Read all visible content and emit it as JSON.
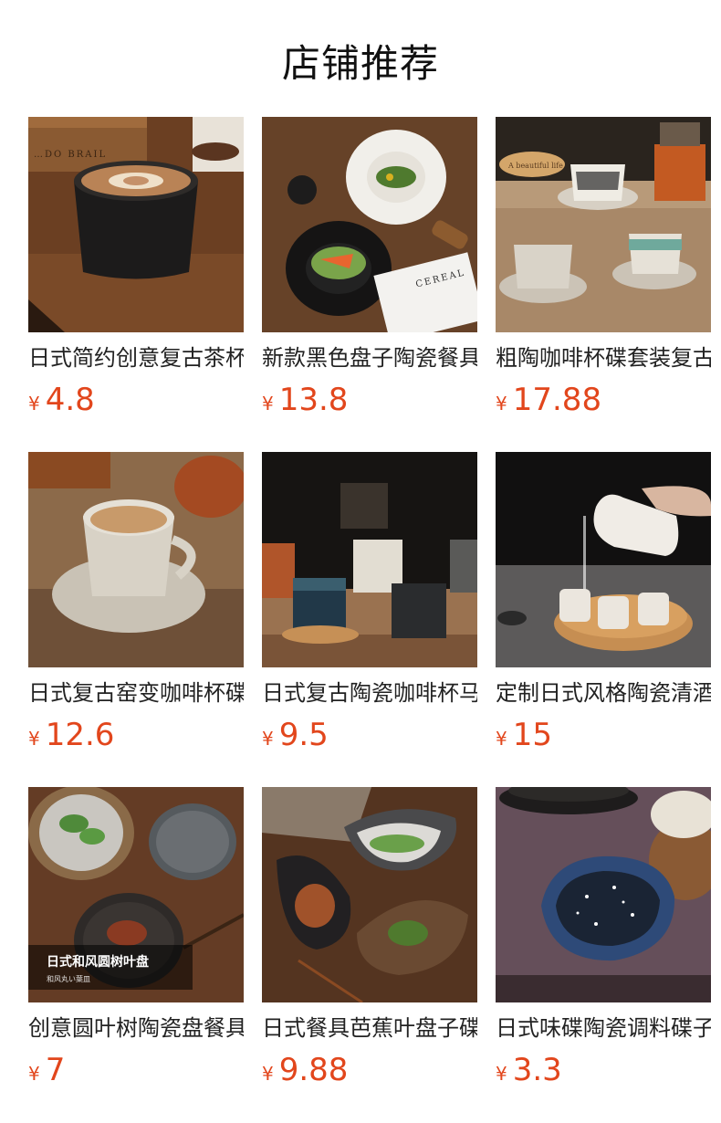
{
  "header": {
    "title": "店铺推荐"
  },
  "products": [
    {
      "name": "日式简约创意复古茶杯",
      "currency": "¥",
      "price": "4.8",
      "image": "black-coffee-cup",
      "image_text": [
        "…DO BRAIL"
      ]
    },
    {
      "name": "新款黑色盘子陶瓷餐具",
      "currency": "¥",
      "price": "13.8",
      "image": "black-plate-salad",
      "image_text": [
        "CEREAL"
      ]
    },
    {
      "name": "粗陶咖啡杯碟套装复古",
      "currency": "¥",
      "price": "17.88",
      "image": "cups-saucers-table",
      "image_text": [
        "A beautiful life"
      ]
    },
    {
      "name": "日式复古窑变咖啡杯碟",
      "currency": "¥",
      "price": "12.6",
      "image": "milk-tea-cup",
      "image_text": []
    },
    {
      "name": "日式复古陶瓷咖啡杯马克杯",
      "currency": "¥",
      "price": "9.5",
      "image": "mugs-stack",
      "image_text": []
    },
    {
      "name": "定制日式风格陶瓷清酒壶",
      "currency": "¥",
      "price": "15",
      "image": "sake-set",
      "image_text": []
    },
    {
      "name": "创意圆叶树陶瓷盘餐具",
      "currency": "¥",
      "price": "7",
      "image": "leaf-plates",
      "image_text": [
        "日式和风圆树叶盘",
        "和风丸い葉皿"
      ]
    },
    {
      "name": "日式餐具芭蕉叶盘子碟",
      "currency": "¥",
      "price": "9.88",
      "image": "banana-leaf-plates",
      "image_text": []
    },
    {
      "name": "日式味碟陶瓷调料碟子",
      "currency": "¥",
      "price": "3.3",
      "image": "sauce-dish",
      "image_text": []
    }
  ]
}
